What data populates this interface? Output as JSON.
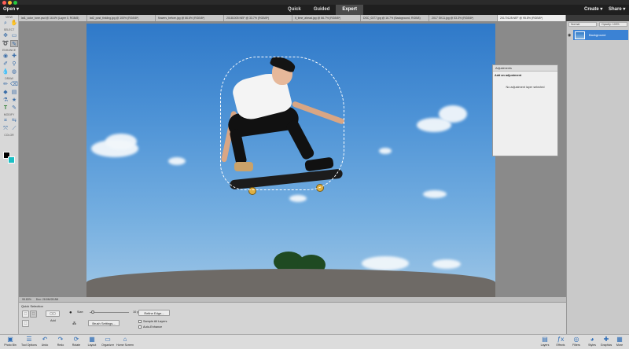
{
  "topbar": {
    "open_label": "Open",
    "modes": [
      "Quick",
      "Guided",
      "Expert"
    ],
    "create_label": "Create",
    "share_label": "Share"
  },
  "doc_tabs": [
    "lat1_color_tone.psd @ 16.6% (Layer 0, RGB/8)",
    "lat2_post_tinkling.jpg @ 100% (RGB/8*)",
    "flowers_before.jpg @ 66.6% (RGB/8*)",
    "20181005 NEF @ 33.7% (RGB/8*)",
    "lt_time_ahead.jpg @ 66.7% (RGB/8*)",
    "DSC_0377.jpg @ 16.7% (Background, RGB/8)",
    "2017 SK11.jpg @ 53.3% (RGB/8*)",
    "20170128.NEF @ 95.8% (RGB/8*)"
  ],
  "toolbox": {
    "sections": [
      "VIEW",
      "SELECT",
      "ENHANCE",
      "DRAW",
      "MODIFY",
      "COLOR"
    ],
    "colors": {
      "foreground": "#000000",
      "background": "#1bbfc4"
    }
  },
  "adjustments": {
    "title": "Adjustments",
    "subtitle": "Add an adjustment",
    "message": "No adjustment layer selected"
  },
  "statusbar": {
    "zoom": "95.83%",
    "doc": "Doc: 28.8M/28.8M"
  },
  "layers": {
    "blend_mode": "Normal",
    "opacity_label": "Opacity:",
    "opacity": "100%",
    "items": [
      {
        "name": "Background"
      }
    ]
  },
  "tool_options": {
    "tool_name": "Quick Selection",
    "add_label": "Add",
    "size_label": "Size:",
    "size_value": "10 px",
    "size_fraction": 0.05,
    "brush_settings": "Brush Settings...",
    "refine_edge": "Refine Edge...",
    "sample_all_layers": "Sample All Layers",
    "auto_enhance": "Auto-Enhance"
  },
  "taskbar": {
    "left": [
      {
        "label": "Photo Bin",
        "icon": "photo-bin-icon"
      },
      {
        "label": "Tool Options",
        "icon": "tool-options-icon"
      },
      {
        "label": "Undo",
        "icon": "undo-icon"
      },
      {
        "label": "Redo",
        "icon": "redo-icon"
      },
      {
        "label": "Rotate",
        "icon": "rotate-icon"
      },
      {
        "label": "Layout",
        "icon": "layout-icon"
      },
      {
        "label": "Organizer",
        "icon": "organizer-icon"
      },
      {
        "label": "Home Screen",
        "icon": "home-icon"
      }
    ],
    "right": [
      {
        "label": "Layers",
        "icon": "layers-icon"
      },
      {
        "label": "Effects",
        "icon": "effects-icon"
      },
      {
        "label": "Filters",
        "icon": "filters-icon"
      },
      {
        "label": "Styles",
        "icon": "styles-icon"
      },
      {
        "label": "Graphics",
        "icon": "graphics-icon"
      },
      {
        "label": "More",
        "icon": "more-icon"
      }
    ]
  }
}
